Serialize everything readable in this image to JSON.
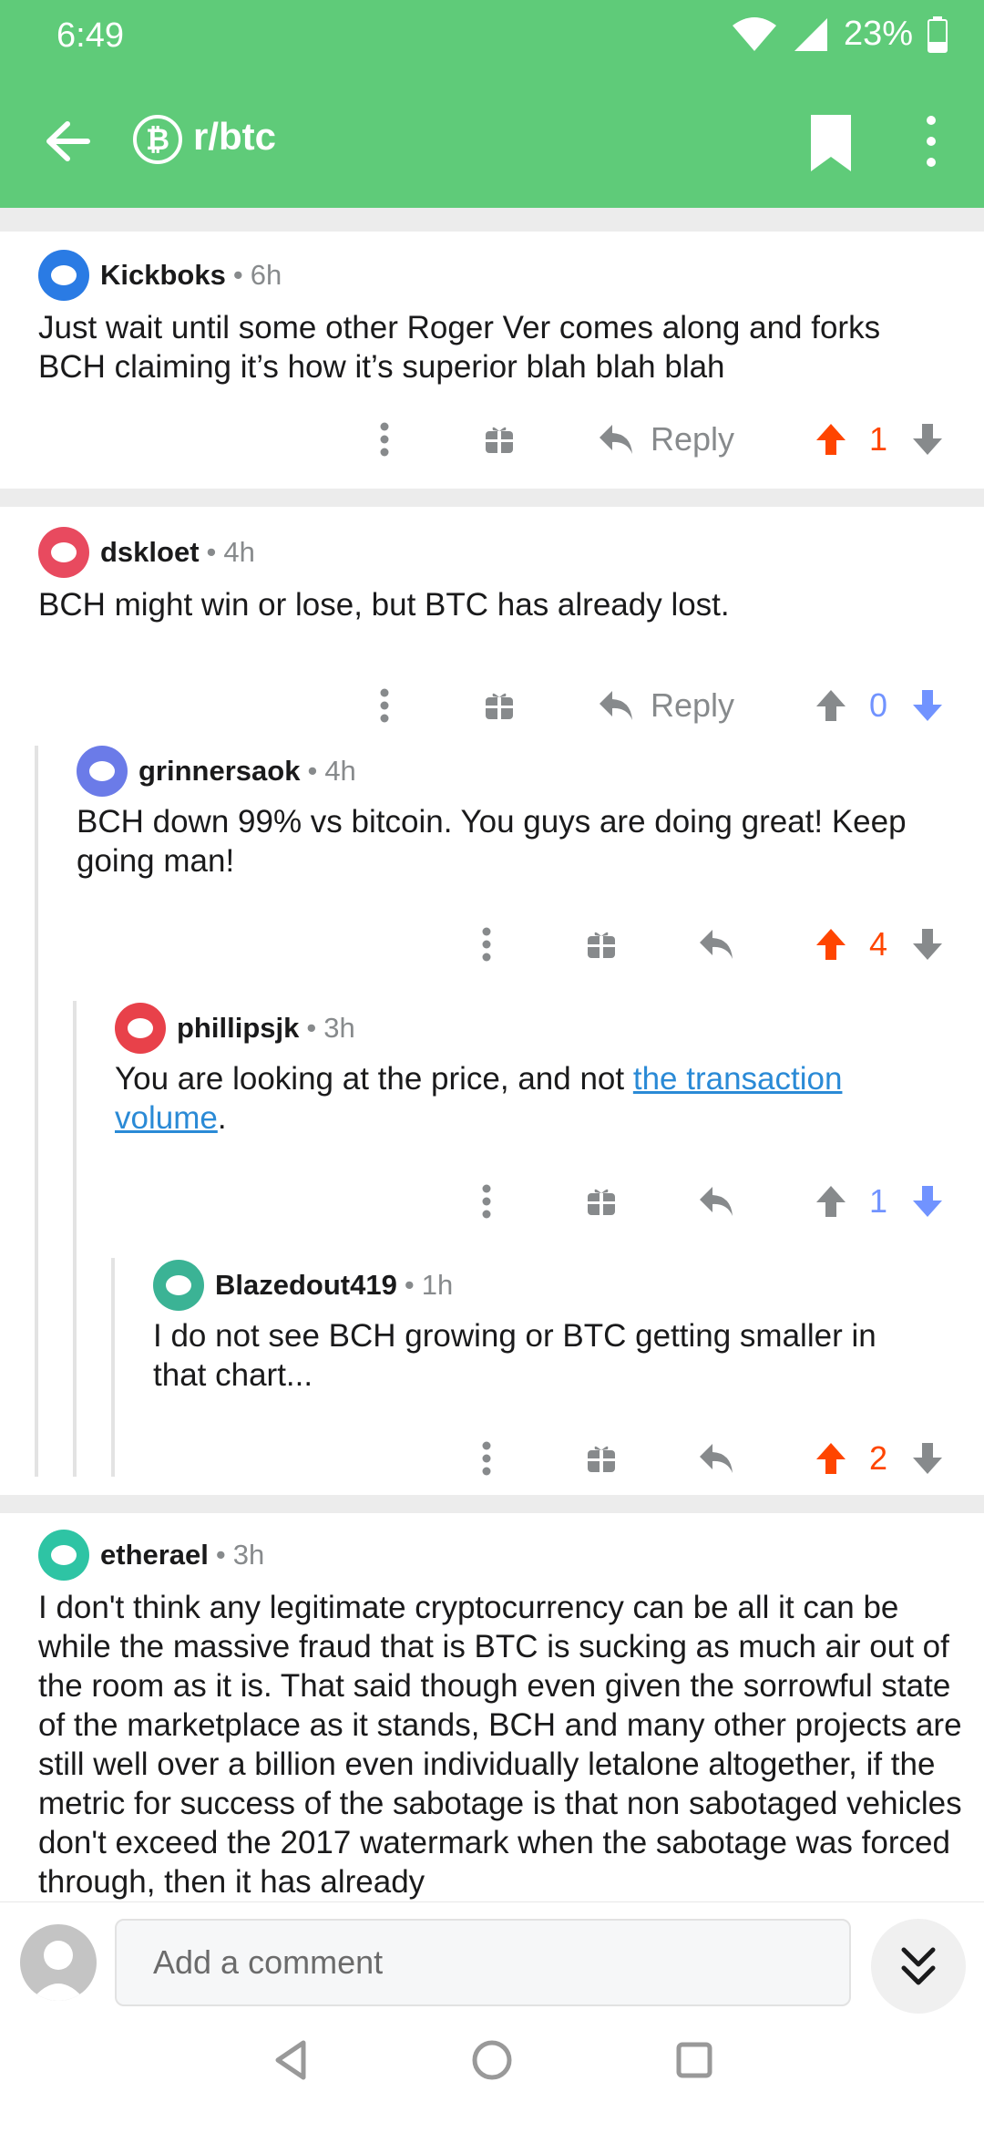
{
  "status_bar": {
    "time": "6:49",
    "battery": "23%"
  },
  "toolbar": {
    "subreddit_glyph": "₿",
    "subreddit": "r/btc"
  },
  "comments": [
    {
      "author": "Kickboks",
      "age": "6h",
      "body": "Just wait until some other Roger Ver comes along and forks BCH claiming it’s how it’s superior blah blah blah",
      "reply_label": "Reply",
      "score": "1",
      "vote": "up",
      "avatar_color": "#2a7be4"
    },
    {
      "author": "dskloet",
      "age": "4h",
      "body": "BCH might win or lose, but BTC has already lost.",
      "reply_label": "Reply",
      "score": "0",
      "vote": "down",
      "avatar_color": "#e84a5f"
    },
    {
      "author": "grinnersaok",
      "age": "4h",
      "body": "BCH down 99% vs bitcoin. You guys are doing great! Keep going man!",
      "score": "4",
      "vote": "up",
      "avatar_color": "#6b7be8"
    },
    {
      "author": "phillipsjk",
      "age": "3h",
      "body_before": "You are looking at the price, and not ",
      "body_link": "the transaction volume",
      "body_after": ".",
      "score": "1",
      "vote": "down",
      "avatar_color": "#e8414a"
    },
    {
      "author": "Blazedout419",
      "age": "1h",
      "body": "I do not see BCH growing or BTC getting smaller in that chart...",
      "score": "2",
      "vote": "up",
      "avatar_color": "#3bb395"
    },
    {
      "author": "etherael",
      "age": "3h",
      "body": "I don't think any legitimate cryptocurrency can be all it can be while the massive fraud that is BTC is sucking as much air out of the room as it is. That said though even given the sorrowful state of the marketplace as it stands, BCH and many other projects are still well over a billion even individually letalone altogether, if the metric for success of the sabotage is that non sabotaged vehicles don't exceed the 2017 watermark when the sabotage was forced through, then it has already",
      "avatar_color": "#2ec4a4"
    }
  ],
  "composer": {
    "placeholder": "Add a comment"
  },
  "colors": {
    "header": "#5fcb79",
    "upvote": "#ff4500",
    "downvote": "#7193ff",
    "neutral": "#878a8c",
    "link": "#2a8ad6"
  }
}
